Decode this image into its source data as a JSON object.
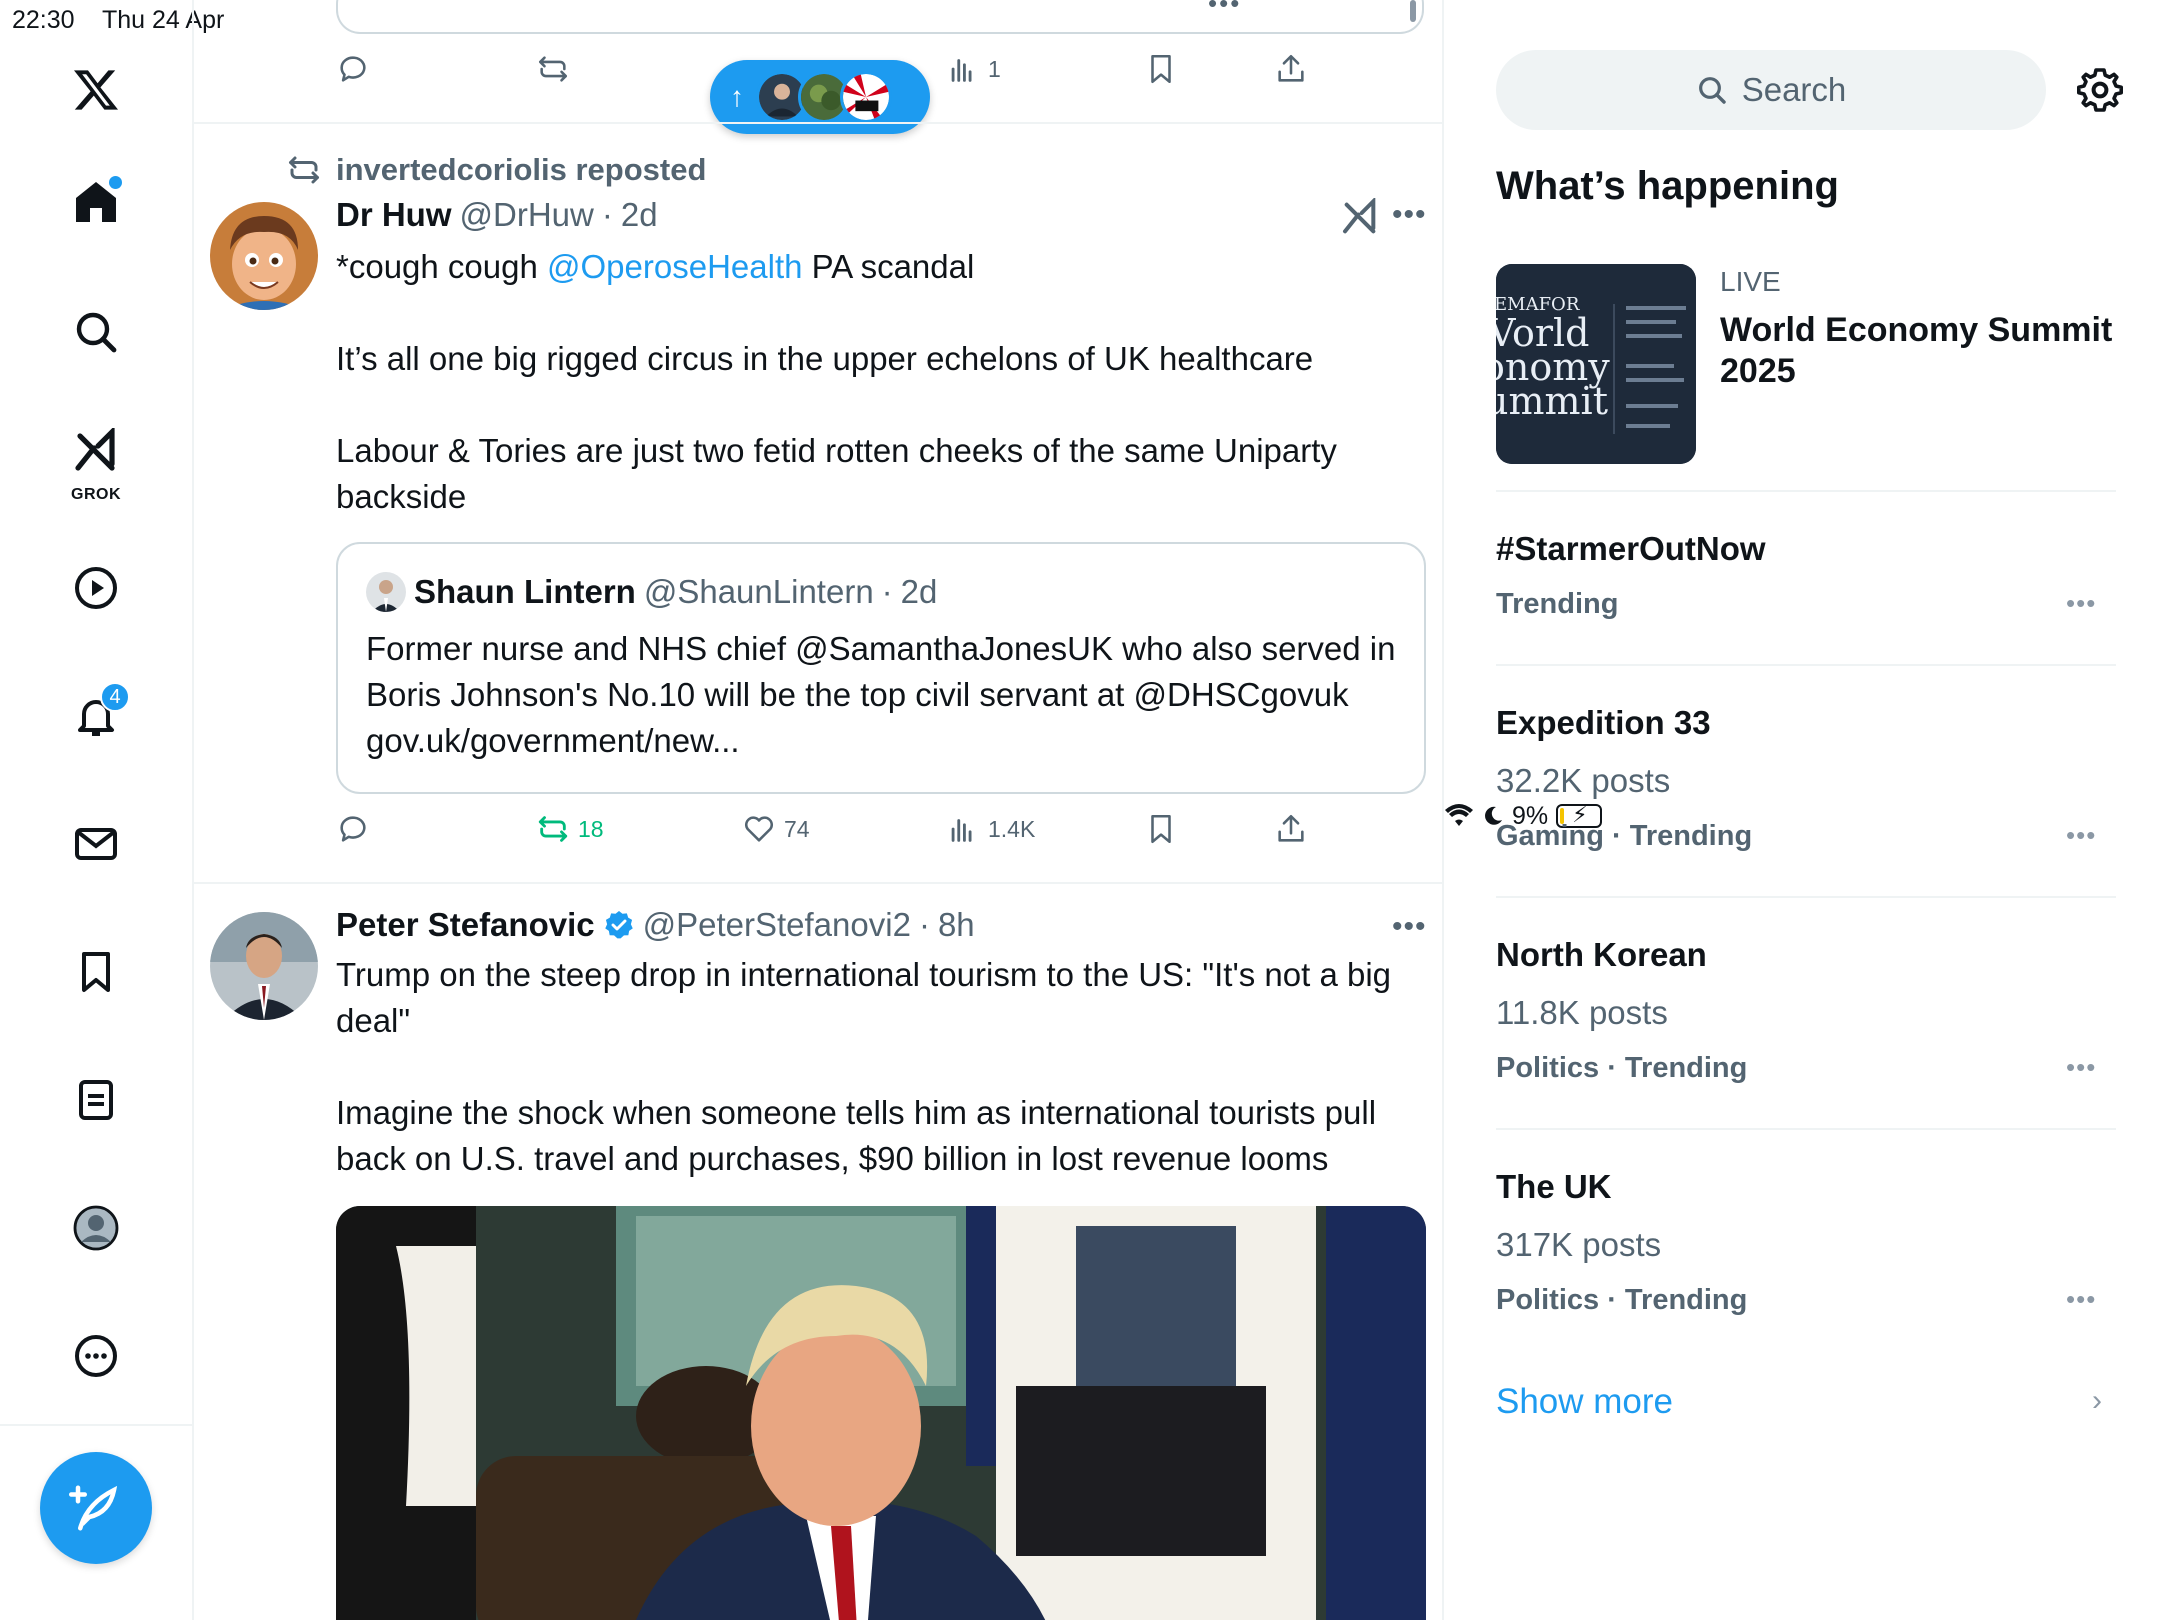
{
  "status_bar": {
    "time": "22:30",
    "date": "Thu 24 Apr",
    "battery": "9%"
  },
  "nav": {
    "grok_label": "GROK",
    "notifications_count": "4"
  },
  "prev_tweet_actions": {
    "views": "1"
  },
  "new_posts_pill": {
    "arrow": "↑"
  },
  "tweet1": {
    "repost_by": "invertedcoriolis reposted",
    "name": "Dr Huw",
    "handle": "@DrHuw",
    "sep": "·",
    "time": "2d",
    "text_pre": "*cough cough ",
    "mention": "@OperoseHealth",
    "text_post": " PA scandal\n\nIt’s all one big rigged circus in the upper echelons of UK healthcare\n\nLabour & Tories are just two fetid rotten cheeks of the same Uniparty backside",
    "quote": {
      "name": "Shaun Lintern",
      "handle": "@ShaunLintern",
      "sep": "·",
      "time": "2d",
      "text": "Former nurse and NHS chief @SamanthaJonesUK who also served in Boris Johnson's No.10 will be the top civil servant at @DHSCgovuk gov.uk/government/new..."
    },
    "reposts": "18",
    "likes": "74",
    "views": "1.4K"
  },
  "tweet2": {
    "name": "Peter Stefanovic",
    "handle": "@PeterStefanovi2",
    "sep": "·",
    "time": "8h",
    "text": "Trump on the steep drop in international tourism to the US: \"It's not a big deal\"\n\nImagine the shock when someone tells him as international tourists pull back on U.S. travel and purchases, $90 billion in lost revenue looms"
  },
  "sidebar": {
    "search_placeholder": "Search",
    "section_title": "What’s happening",
    "live": {
      "label": "LIVE",
      "title": "World Economy Summit 2025",
      "image_text": [
        "EMAFOR",
        "Vorld",
        "onomy",
        "ummit"
      ]
    },
    "trends": [
      {
        "name": "#StarmerOutNow",
        "posts": "",
        "meta": "Trending"
      },
      {
        "name": "Expedition 33",
        "posts": "32.2K posts",
        "meta": "Gaming · Trending"
      },
      {
        "name": "North Korean",
        "posts": "11.8K posts",
        "meta": "Politics · Trending"
      },
      {
        "name": "The UK",
        "posts": "317K posts",
        "meta": "Politics · Trending"
      }
    ],
    "show_more": "Show more"
  },
  "colors": {
    "accent": "#1d9bf0",
    "repost_green": "#00ba7c",
    "secondary_text": "#536471"
  }
}
